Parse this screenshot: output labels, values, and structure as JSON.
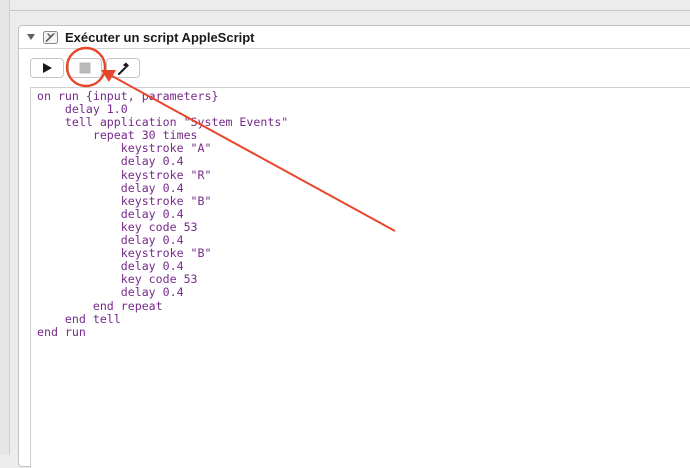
{
  "window": {
    "action_title": "Exécuter un script AppleScript"
  },
  "icons": {
    "collapse": "disclosure-triangle-icon",
    "action": "applescript-scroll-icon",
    "run": "play-icon",
    "stop": "stop-icon",
    "compile": "hammer-icon"
  },
  "script": {
    "lines": [
      "on run {input, parameters}",
      "    delay 1.0",
      "    tell application \"System Events\"",
      "        repeat 30 times",
      "            keystroke \"A\"",
      "            delay 0.4",
      "            keystroke \"R\"",
      "            delay 0.4",
      "            keystroke \"B\"",
      "            delay 0.4",
      "            key code 53",
      "            delay 0.4",
      "            keystroke \"B\"",
      "            delay 0.4",
      "            key code 53",
      "            delay 0.4",
      "        end repeat",
      "    end tell",
      "end run"
    ]
  },
  "colors": {
    "code_text": "#762a8a",
    "annotation": "#e8462a"
  }
}
